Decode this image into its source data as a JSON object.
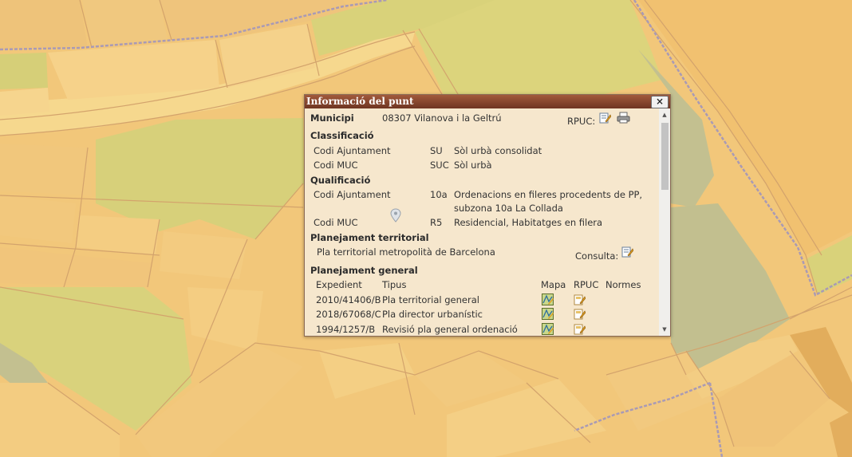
{
  "popup": {
    "title": "Informació del punt",
    "close_label": "×",
    "municipi": {
      "label": "Municipi",
      "value": "08307 Vilanova i la Geltrú",
      "rpuc_label": "RPUC:"
    },
    "classificacio": {
      "heading": "Classificació",
      "rows": [
        {
          "label": "Codi Ajuntament",
          "code": "SU",
          "desc": "Sòl urbà consolidat"
        },
        {
          "label": "Codi MUC",
          "code": "SUC",
          "desc": "Sòl urbà"
        }
      ]
    },
    "qualificacio": {
      "heading": "Qualificació",
      "rows": [
        {
          "label": "Codi Ajuntament",
          "code": "10a",
          "desc": "Ordenacions en fileres procedents de PP,",
          "desc2": "subzona 10a La Collada"
        },
        {
          "label": "Codi MUC",
          "code": "R5",
          "desc": "Residencial, Habitatges en filera"
        }
      ]
    },
    "territorial": {
      "heading": "Planejament territorial",
      "value": "Pla territorial metropolità de Barcelona",
      "consulta_label": "Consulta:"
    },
    "general": {
      "heading": "Planejament general",
      "columns": {
        "expedient": "Expedient",
        "tipus": "Tipus",
        "mapa": "Mapa",
        "rpuc": "RPUC",
        "normes": "Normes"
      },
      "rows": [
        {
          "expedient": "2010/41406/B",
          "tipus": "Pla territorial general"
        },
        {
          "expedient": "2018/67068/C",
          "tipus": "Pla director urbanístic"
        },
        {
          "expedient": "1994/1257/B",
          "tipus": "Revisió pla general ordenació"
        }
      ]
    }
  },
  "colors": {
    "map_background": "#f2c77a",
    "block_yellow": "#f4d48a",
    "block_orange": "#f1c375",
    "street": "#e9c08e",
    "green_zone": "#d9d27a",
    "green_zone_light": "#e3d47c",
    "grey_zone": "#c3c090",
    "boundary": "#9c89a8",
    "title_bar": "#8a4529"
  }
}
